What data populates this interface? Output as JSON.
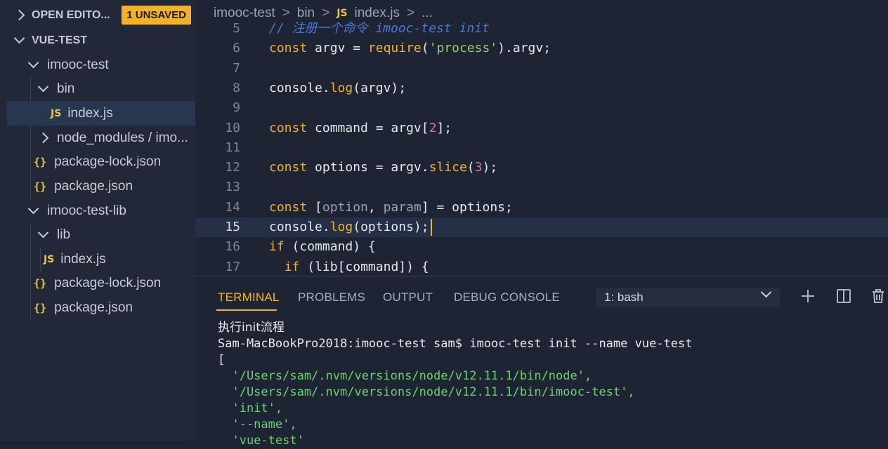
{
  "sidebar": {
    "open_editors": {
      "label": "OPEN EDITO...",
      "badge": "1 UNSAVED"
    },
    "workspace": {
      "label": "VUE-TEST"
    },
    "tree": [
      {
        "label": "imooc-test",
        "type": "folder-open"
      },
      {
        "label": "bin",
        "type": "folder-open"
      },
      {
        "label": "index.js",
        "type": "js",
        "icon_text": "JS"
      },
      {
        "label": "node_modules / imo...",
        "type": "folder-closed"
      },
      {
        "label": "package-lock.json",
        "type": "json",
        "icon_text": "{}"
      },
      {
        "label": "package.json",
        "type": "json",
        "icon_text": "{}"
      },
      {
        "label": "imooc-test-lib",
        "type": "folder-open"
      },
      {
        "label": "lib",
        "type": "folder-open"
      },
      {
        "label": "index.js",
        "type": "js",
        "icon_text": "JS"
      },
      {
        "label": "package-lock.json",
        "type": "json",
        "icon_text": "{}"
      },
      {
        "label": "package.json",
        "type": "json",
        "icon_text": "{}"
      }
    ]
  },
  "breadcrumb": {
    "items": [
      "imooc-test",
      "bin",
      "index.js",
      "..."
    ],
    "js_icon": "JS",
    "separator": ">"
  },
  "editor": {
    "lines": [
      {
        "n": "5",
        "text": "// 注册一个命令 imooc-test init"
      },
      {
        "n": "6",
        "text": "const argv = require('process').argv;"
      },
      {
        "n": "7",
        "text": ""
      },
      {
        "n": "8",
        "text": "console.log(argv);"
      },
      {
        "n": "9",
        "text": ""
      },
      {
        "n": "10",
        "text": "const command = argv[2];"
      },
      {
        "n": "11",
        "text": ""
      },
      {
        "n": "12",
        "text": "const options = argv.slice(3);"
      },
      {
        "n": "13",
        "text": ""
      },
      {
        "n": "14",
        "text": "const [option, param] = options;"
      },
      {
        "n": "15",
        "text": "console.log(options);"
      },
      {
        "n": "16",
        "text": "if (command) {"
      },
      {
        "n": "17",
        "text": "  if (lib[command]) {"
      }
    ],
    "current_line": "15"
  },
  "panel": {
    "tabs": [
      "TERMINAL",
      "PROBLEMS",
      "OUTPUT",
      "DEBUG CONSOLE"
    ],
    "active_tab": "TERMINAL",
    "terminal_select": "1: bash",
    "icons": [
      "plus-icon",
      "split-icon",
      "trash-icon"
    ],
    "terminal_lines": [
      "执行init流程",
      "Sam-MacBookPro2018:imooc-test sam$ imooc-test init --name vue-test",
      "[",
      "  '/Users/sam/.nvm/versions/node/v12.11.1/bin/node',",
      "  '/Users/sam/.nvm/versions/node/v12.11.1/bin/imooc-test',",
      "  'init',",
      "  '--name',",
      "  'vue-test'"
    ]
  },
  "colors": {
    "accent": "#f0b429",
    "editor_bg": "#1e2433",
    "sidebar_bg": "#222837",
    "string_green": "#8fd16a",
    "number_pink": "#e06c9f"
  }
}
